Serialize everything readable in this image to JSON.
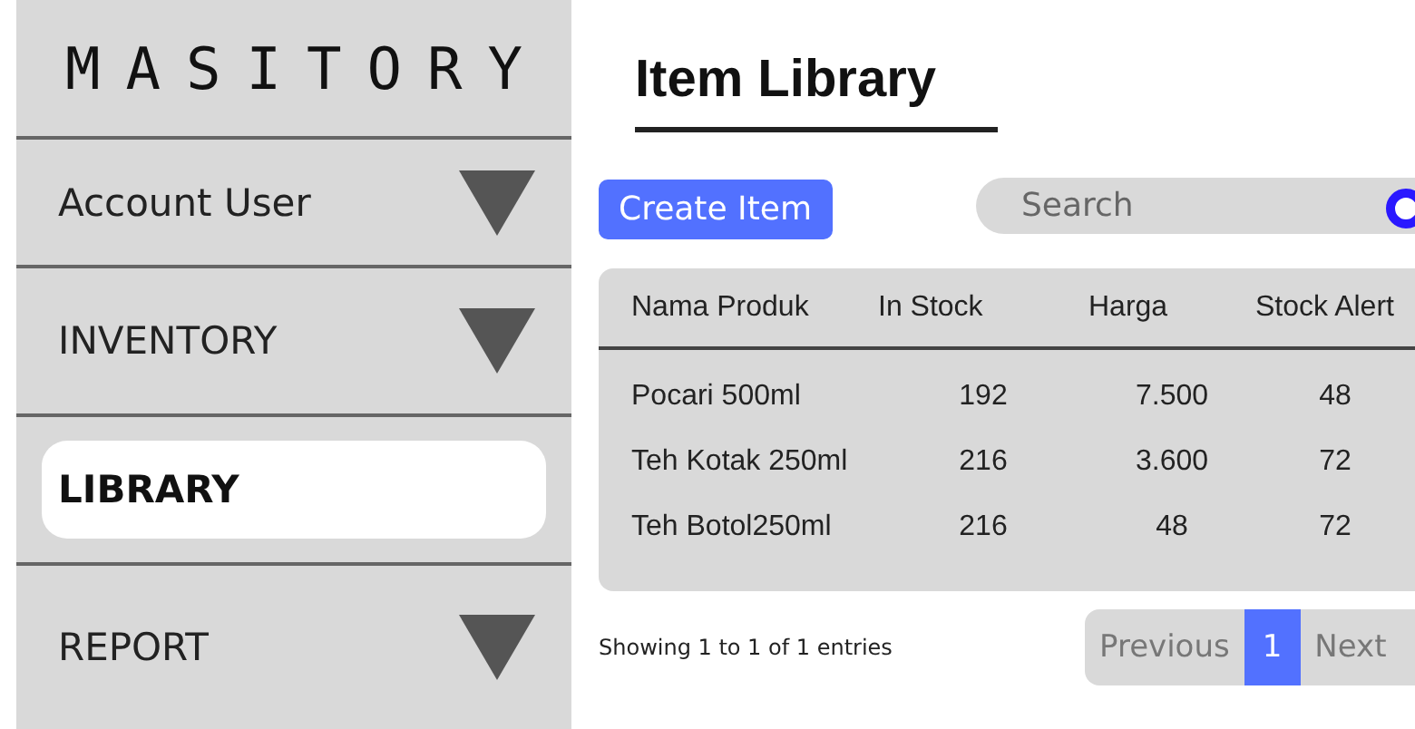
{
  "sidebar": {
    "logo": "MASITORY",
    "items": [
      {
        "label": "Account User",
        "selected": false,
        "expandable": true
      },
      {
        "label": "INVENTORY",
        "selected": false,
        "expandable": true
      },
      {
        "label": "LIBRARY",
        "selected": true,
        "expandable": false
      },
      {
        "label": "REPORT",
        "selected": false,
        "expandable": true
      }
    ]
  },
  "page_title": "Item Library",
  "create_button": "Create Item",
  "search": {
    "placeholder": "Search"
  },
  "table": {
    "columns": [
      "Nama Produk",
      "In Stock",
      "Harga",
      "Stock Alert"
    ],
    "rows": [
      [
        "Pocari 500ml",
        "192",
        "7.500",
        "48"
      ],
      [
        "Teh Kotak 250ml",
        "216",
        "3.600",
        "72"
      ],
      [
        "Teh Botol250ml",
        "216",
        "48",
        "72"
      ]
    ]
  },
  "footer_text": "Showing 1 to 1 of 1 entries",
  "pagination": [
    {
      "label": "Previous",
      "selected": false
    },
    {
      "label": "1",
      "selected": true
    },
    {
      "label": "Next",
      "selected": false
    }
  ]
}
